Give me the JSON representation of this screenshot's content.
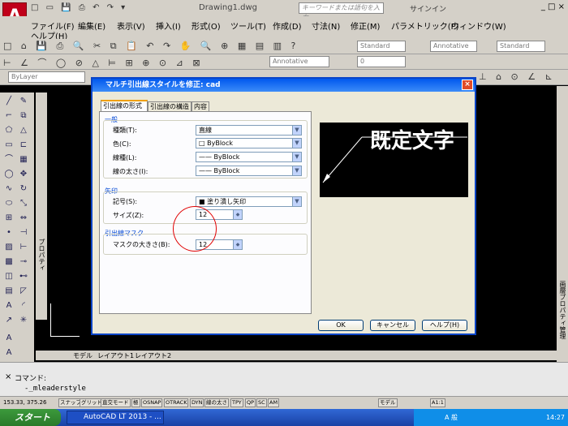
{
  "app": {
    "logo": "A",
    "title": "Drawing1.dwg",
    "search_placeholder": "キーワードまたは語句を入力",
    "signin": "サインイン",
    "window_controls": "_ □ ×"
  },
  "menu": [
    "ファイル(F)",
    "編集(E)",
    "表示(V)",
    "挿入(I)",
    "形式(O)",
    "ツール(T)",
    "作成(D)",
    "寸法(N)",
    "修正(M)",
    "パラメトリック(P)",
    "ウィンドウ(W)",
    "ヘルプ(H)"
  ],
  "toolbar": {
    "style1": "Standard",
    "style2": "Annotative",
    "style3": "Standard",
    "layer": "ByLayer",
    "annotative_label": "Annotative",
    "layer_num": "0"
  },
  "dialog": {
    "title": "マルチ引出線スタイルを修正: cad",
    "close": "×",
    "tabs": [
      "引出線の形式",
      "引出線の構造",
      "内容"
    ],
    "general": {
      "title": "一般",
      "type_label": "種類(T):",
      "type_value": "直線",
      "color_label": "色(C):",
      "color_value": "ByBlock",
      "linetype_label": "線種(L):",
      "linetype_value": "ByBlock",
      "lineweight_label": "線の太さ(I):",
      "lineweight_value": "ByBlock"
    },
    "arrow": {
      "title": "矢印",
      "symbol_label": "記号(S):",
      "symbol_value": "塗り潰し矢印",
      "size_label": "サイズ(Z):",
      "size_value": "12"
    },
    "break": {
      "title": "引出線マスク",
      "size_label": "マスクの大きさ(B):",
      "size_value": "12"
    },
    "preview_text": "既定文字",
    "ok": "OK",
    "cancel": "キャンセル",
    "help": "ヘルプ(H)"
  },
  "side_panels": {
    "left_props": "プロパティ",
    "right_panel": "画層プロパティ管理"
  },
  "layout_tabs": [
    "モデル",
    "レイアウト1",
    "レイアウト2"
  ],
  "command": {
    "label": "コマンド:",
    "input": "-_mleaderstyle",
    "close": "×"
  },
  "status": {
    "coords": "153.33, 375.26",
    "buttons": [
      "スナップ",
      "グリッド",
      "直交モード",
      "極",
      "OSNAP",
      "OTRACK",
      "DYN",
      "線の太さ",
      "TPY",
      "QP",
      "SC",
      "AM"
    ],
    "right": [
      "モデル",
      "A1:1"
    ]
  },
  "taskbar": {
    "start": "スタート",
    "task": "AutoCAD LT 2013 - ...",
    "clock": "14:27",
    "tray_text": "A 般"
  }
}
